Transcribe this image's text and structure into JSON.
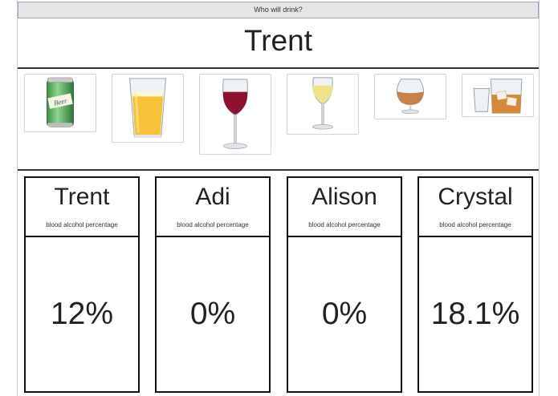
{
  "header": {
    "button_label": "Who will drink?",
    "current_drinker": "Trent"
  },
  "drinks": [
    {
      "icon": "beer-can-icon"
    },
    {
      "icon": "beer-glass-icon"
    },
    {
      "icon": "red-wine-glass-icon"
    },
    {
      "icon": "white-wine-glass-icon"
    },
    {
      "icon": "brandy-snifter-icon"
    },
    {
      "icon": "whiskey-glasses-icon"
    }
  ],
  "people": [
    {
      "name": "Trent",
      "subtitle": "blood alcohol percentage",
      "value": "12%"
    },
    {
      "name": "Adi",
      "subtitle": "blood alcohol percentage",
      "value": "0%"
    },
    {
      "name": "Alison",
      "subtitle": "blood alcohol percentage",
      "value": "0%"
    },
    {
      "name": "Crystal",
      "subtitle": "blood alcohol percentage",
      "value": "18.1%"
    }
  ]
}
